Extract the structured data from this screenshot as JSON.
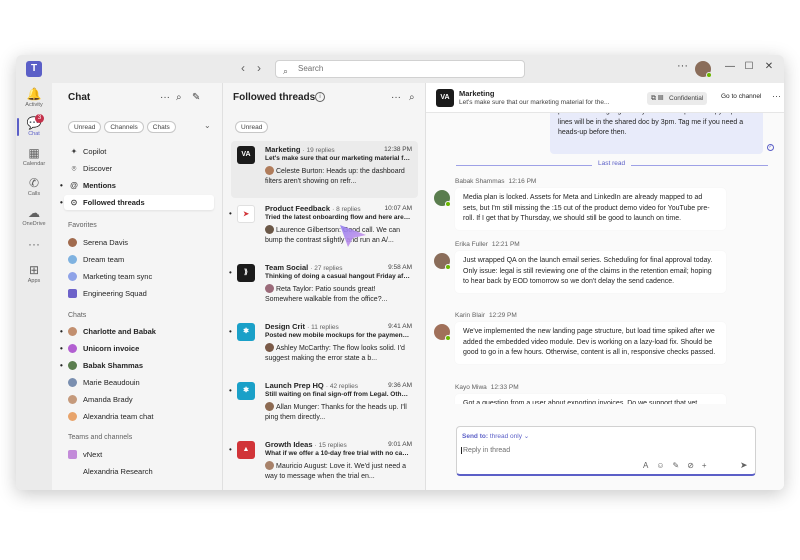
{
  "titlebar": {
    "search_placeholder": "Search",
    "more_label": "···",
    "back_icon": "chevron-left-icon",
    "forward_icon": "chevron-right-icon"
  },
  "rail": {
    "items": [
      {
        "label": "Activity",
        "icon": "bell-icon",
        "glyph": "🔔"
      },
      {
        "label": "Chat",
        "icon": "chat-icon",
        "glyph": "💬",
        "badge": "3"
      },
      {
        "label": "Calendar",
        "icon": "calendar-icon",
        "glyph": "▦"
      },
      {
        "label": "Calls",
        "icon": "phone-icon",
        "glyph": "✆"
      },
      {
        "label": "OneDrive",
        "icon": "cloud-icon",
        "glyph": "☁"
      },
      {
        "label": "",
        "icon": "more-icon",
        "glyph": "···"
      },
      {
        "label": "Apps",
        "icon": "apps-icon",
        "glyph": "⊞"
      }
    ]
  },
  "chat_pane": {
    "title": "Chat",
    "filters": [
      "Unread",
      "Channels",
      "Chats"
    ],
    "nav": [
      {
        "label": "Copilot",
        "glyph": "✦"
      },
      {
        "label": "Discover",
        "glyph": "⌾"
      },
      {
        "label": "Mentions",
        "glyph": "@"
      },
      {
        "label": "Followed threads",
        "glyph": "⊙"
      }
    ],
    "favorites_heading": "Favorites",
    "favorites": [
      {
        "label": "Serena Davis",
        "color": "#a16b4e"
      },
      {
        "label": "Dream team",
        "color": "#7fb2e0"
      },
      {
        "label": "Marketing team sync",
        "color": "#8fa3e8"
      },
      {
        "label": "Engineering Squad",
        "color": "#6d62c9"
      }
    ],
    "chats_heading": "Chats",
    "chats": [
      {
        "label": "Charlotte and Babak",
        "color": "#c28f6f"
      },
      {
        "label": "Unicorn invoice",
        "color": "#b25fd1"
      },
      {
        "label": "Babak Shammas",
        "color": "#5a7d4e"
      },
      {
        "label": "Marie Beaudouin",
        "color": "#7a8fb0"
      },
      {
        "label": "Amanda Brady",
        "color": "#c59a7c"
      },
      {
        "label": "Alexandria team chat",
        "color": "#e8a46b"
      }
    ],
    "teams_heading": "Teams and channels",
    "teams": [
      {
        "label": "vNext",
        "color": "#c38bd9"
      },
      {
        "label": "Alexandria Research",
        "color": ""
      }
    ]
  },
  "threads_pane": {
    "title": "Followed threads",
    "filter": "Unread",
    "threads": [
      {
        "name": "Marketing",
        "replies": "· 19 replies",
        "time": "12:38 PM",
        "subject": "Let's make sure that our marketing material for t...",
        "author": "Celeste Burton:",
        "reply": "Heads up: the dashboard filters aren't showing on refr...",
        "logo_color": "#1b1b1b",
        "logo_text": "VA",
        "avatar": "#b07c5b"
      },
      {
        "name": "Product Feedback",
        "replies": "· 8 replies",
        "time": "10:07 AM",
        "subject": "Tried the latest onboarding flow and here are my...",
        "author": "Laurence Gilbertson:",
        "reply": "Good call. We can bump the contrast slightly and run an A/...",
        "logo_color": "#ffffff",
        "logo_text": "➤",
        "avatar": "#6b5848"
      },
      {
        "name": "Team Social",
        "replies": "· 27 replies",
        "time": "9:58 AM",
        "subject": "Thinking of doing a casual hangout Friday afte...",
        "author": "Reta Taylor:",
        "reply": "Patio sounds great! Somewhere walkable from the office?...",
        "logo_color": "#1b1b1b",
        "logo_text": "⟫",
        "avatar": "#9b6b7a"
      },
      {
        "name": "Design Crit",
        "replies": "· 11 replies",
        "time": "9:41 AM",
        "subject": "Posted new mobile mockups for the payments screen...",
        "author": "Ashley McCarthy:",
        "reply": "The flow looks solid. I'd suggest making the error state a b...",
        "logo_color": "#1aa0c8",
        "logo_text": "✱",
        "avatar": "#7a5a48"
      },
      {
        "name": "Launch Prep HQ",
        "replies": "· 42 replies",
        "time": "9:36 AM",
        "subject": "Still waiting on final sign-off from Legal. Other...",
        "author": "Allan Munger:",
        "reply": "Thanks for the heads up. I'll ping them directly...",
        "logo_color": "#1aa0c8",
        "logo_text": "✱",
        "avatar": "#8c6a52"
      },
      {
        "name": "Growth Ideas",
        "replies": "· 15 replies",
        "time": "9:01 AM",
        "subject": "What if we offer a 10-day free trial with no card...",
        "author": "Mauricio August:",
        "reply": "Love it. We'd just need a way to message when the trial en...",
        "logo_color": "#d13438",
        "logo_text": "▲",
        "avatar": "#a8826a"
      }
    ]
  },
  "conversation": {
    "title": "Marketing",
    "subtitle": "Let's make sure that our marketing material for the...",
    "confidential": "Confidential",
    "go_to_channel": "Go to channel",
    "my_message": "promotional language until you see the updated copy. Updated lines will be in the shared doc by 3pm. Tag me if you need a heads-up before then.",
    "last_read": "Last read",
    "messages": [
      {
        "author": "Babak Shammas",
        "time": "12:16 PM",
        "text": "Media plan is locked. Assets for Meta and LinkedIn are already mapped to ad sets, but I'm still missing the :15 cut of the product demo video for YouTube pre-roll. If I get that by Thursday, we should still be good to launch on time.",
        "color": "#5a7d4e"
      },
      {
        "author": "Erika Fuller",
        "time": "12:21 PM",
        "text": "Just wrapped QA on the launch email series. Scheduling for final approval today. Only issue: legal is still reviewing one of the claims in the retention email; hoping to hear back by EOD tomorrow so we don't delay the send cadence.",
        "color": "#8a6d5a"
      },
      {
        "author": "Karin Blair",
        "time": "12:29 PM",
        "text": "We've implemented the new landing page structure, but load time spiked after we added the embedded video module. Dev is working on a lazy-load fix. Should be good to go in a few hours. Otherwise, content is all in, responsive checks passed.",
        "color": "#a0705a"
      },
      {
        "author": "Kayo Miwa",
        "time": "12:33 PM",
        "text": "Got a question from a user about exporting invoices. Do we support that yet",
        "color": "#6d5a7a"
      }
    ],
    "composer": {
      "send_to_label": "Send to:",
      "send_to_value": "thread only",
      "placeholder": "Reply in thread"
    }
  },
  "colors": {
    "accent": "#5b5fc7",
    "presence": "#6bb700",
    "badge": "#c4314b"
  }
}
